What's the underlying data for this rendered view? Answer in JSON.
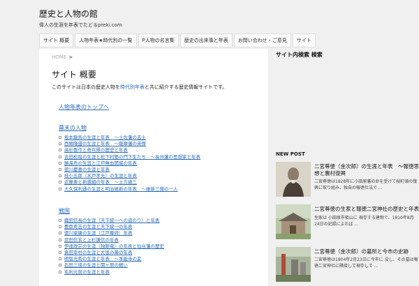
{
  "site": {
    "title": "歴史と人物の館",
    "tagline": "偉人の生涯を年表でたどるpreki.com"
  },
  "nav": [
    {
      "label": "サイト 概要"
    },
    {
      "label": "人物年表★時代別の一覧"
    },
    {
      "label": "P人物の名言集"
    },
    {
      "label": "歴史の出来事と年表"
    },
    {
      "label": "お問い合わせ・ご意見"
    },
    {
      "label": "サイト"
    }
  ],
  "breadcrumb": {
    "home": "HOME",
    "sep": ">"
  },
  "page": {
    "title": "サイト 概要",
    "intro_before": "このサイトは日本の歴史人物を",
    "intro_link": "時代別年表",
    "intro_after": "と共に紹介する歴史情報サイトです。"
  },
  "sections": [
    {
      "heading": "人物年表のトップへ",
      "items": []
    },
    {
      "heading": "幕末の人物",
      "items": [
        "坂本龍馬の生涯と年表　～土佐藩の志士",
        "西郷隆盛の生涯と年表　～薩摩藩の英傑",
        "高杉晋作と奇兵隊の歴史と年表",
        "吉田松陰の生涯と松下村塾の門下生たち　～長州藩の思想家と年表",
        "勝海舟の生涯と江戸無血開城の年表",
        "徳川慶喜の生涯と年表",
        "桂小五郎（木戸孝允）の生涯と年表",
        "近藤勇と新選組の年表　～土方歳三",
        "大久保利通の生涯と明治維新の年表　～維新三傑の一人"
      ]
    },
    {
      "heading": "戦国",
      "items": [
        "織田信長の生涯（天下統一への道のり）と年表",
        "豊臣秀吉の生涯と天下統一の年表",
        "徳川家康の生涯（江戸幕府）年表",
        "武田信玄と上杉謙信の年表",
        "伊達政宗の生涯（独眼竜）の年表と仙台藩の歴史",
        "真田幸村の生涯と大坂の陣の年表",
        "明智光秀の生涯と年表　～本能寺の変",
        "石田三成の生涯と関ヶ原の戦い",
        "毛利元就の生涯と年表"
      ]
    }
  ],
  "sidebar": {
    "search_heading": "サイト内検索 検索",
    "new_post_heading": "NEW POST",
    "posts": [
      {
        "title": "二宮尊徳（金次郎）の生涯と年表　～報徳思想と農村復興",
        "excerpt": "二宮尊徳は1828年に小田原藩の命を受けて桜町領の復興に取り組み、独自の報徳仕法で ..."
      },
      {
        "title": "二宮尊徳の生家と報徳二宮神社の歴史と年表",
        "excerpt": "生家は 小田原市栢山に 現存する建物で、1810年8月24日の記録によれば ..."
      },
      {
        "title": "二宮尊徳（金次郎）の墓所と今市の史跡",
        "excerpt": "二宮尊徳は1804年2月23日に今市に 没し、その墓は報徳二宮神社に隣接して現存して ..."
      }
    ]
  }
}
